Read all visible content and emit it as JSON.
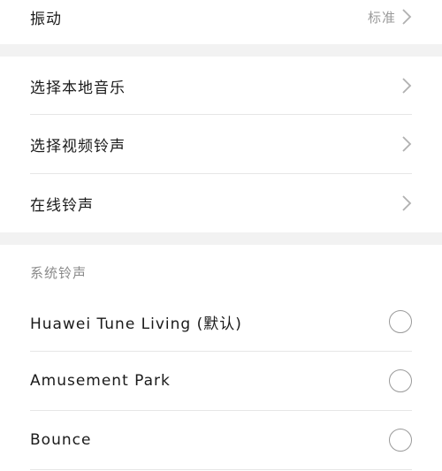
{
  "vibration": {
    "label": "振动",
    "value": "标准"
  },
  "ringtone_sources": [
    {
      "label": "选择本地音乐"
    },
    {
      "label": "选择视频铃声"
    },
    {
      "label": "在线铃声"
    }
  ],
  "system_ringtones": {
    "header": "系统铃声",
    "items": [
      {
        "label": "Huawei Tune Living (默认)"
      },
      {
        "label": "Amusement Park"
      },
      {
        "label": "Bounce"
      }
    ]
  },
  "icons": {
    "chevron": "chevron-right-icon",
    "radio": "radio-unselected-icon"
  },
  "colors": {
    "gap": "#f2f2f2",
    "divider": "#e6e6e6",
    "secondary_text": "#9a9a9a"
  }
}
